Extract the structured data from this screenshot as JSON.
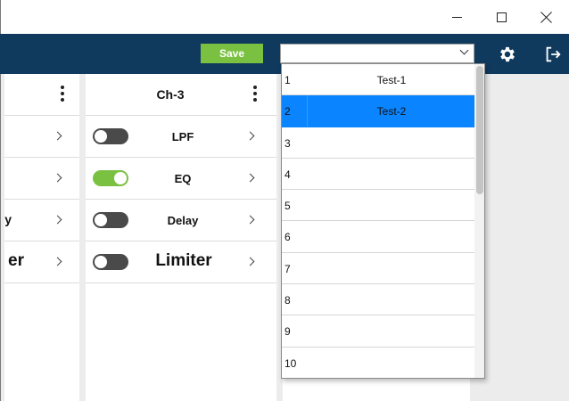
{
  "window": {
    "minimize_icon": "minimize-icon",
    "maximize_icon": "maximize-icon",
    "close_icon": "close-icon"
  },
  "header": {
    "save_label": "Save",
    "preset_selected": "",
    "settings_icon": "gear-icon",
    "logout_icon": "logout-icon",
    "bg_color": "#0f3a5e",
    "accent_color": "#7ac142"
  },
  "left_channel": {
    "rows": [
      {
        "label": ""
      },
      {
        "label": ""
      },
      {
        "label": "y"
      },
      {
        "label": "er"
      }
    ]
  },
  "ch3": {
    "title": "Ch-3",
    "rows": [
      {
        "label": "LPF",
        "enabled": false
      },
      {
        "label": "EQ",
        "enabled": true
      },
      {
        "label": "Delay",
        "enabled": false
      },
      {
        "label": "Limiter",
        "enabled": false
      }
    ]
  },
  "preset_dropdown": {
    "items": [
      {
        "num": "1",
        "name": "Test-1"
      },
      {
        "num": "2",
        "name": "Test-2",
        "selected": true
      },
      {
        "num": "3",
        "name": ""
      },
      {
        "num": "4",
        "name": ""
      },
      {
        "num": "5",
        "name": ""
      },
      {
        "num": "6",
        "name": ""
      },
      {
        "num": "7",
        "name": ""
      },
      {
        "num": "8",
        "name": ""
      },
      {
        "num": "9",
        "name": ""
      },
      {
        "num": "10",
        "name": ""
      }
    ],
    "selected_color": "#0a84ff"
  }
}
